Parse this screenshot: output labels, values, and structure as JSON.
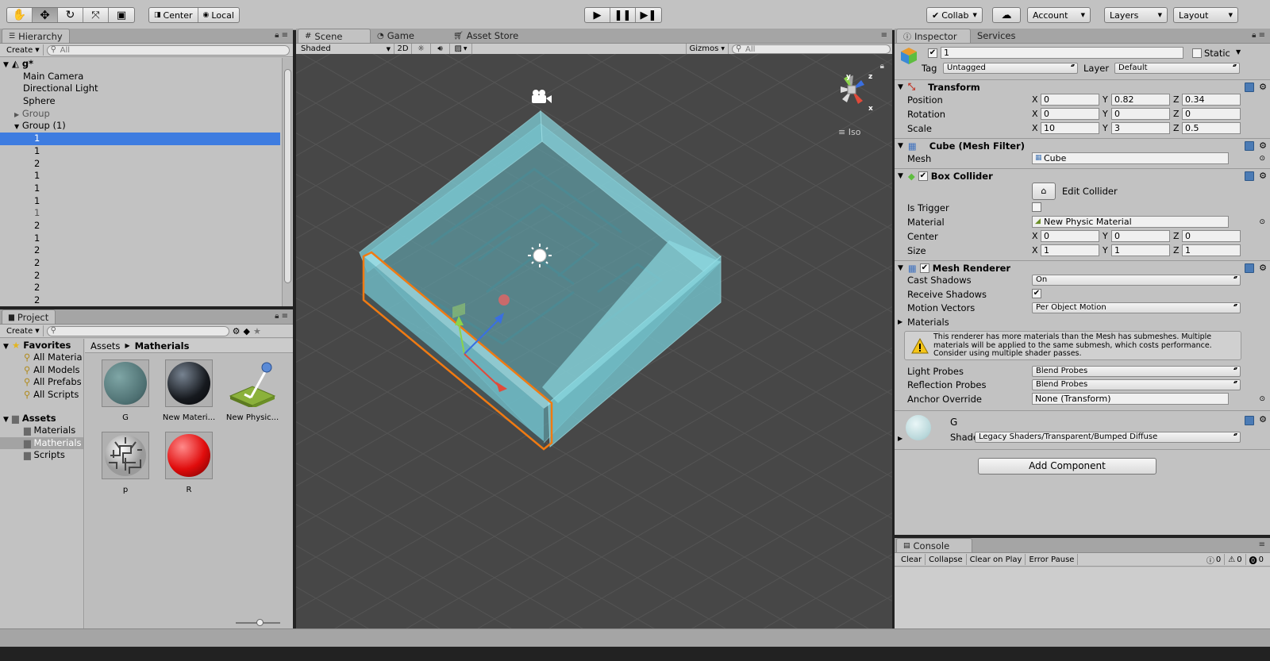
{
  "toolbar": {
    "pivot_center": "Center",
    "pivot_local": "Local",
    "collab": "Collab",
    "account": "Account",
    "layers": "Layers",
    "layout": "Layout"
  },
  "hierarchy": {
    "tab": "Hierarchy",
    "create": "Create",
    "search_placeholder": "All",
    "scene_name": "g*",
    "items": [
      {
        "label": "Main Camera"
      },
      {
        "label": "Directional Light"
      },
      {
        "label": "Sphere"
      },
      {
        "label": "Group"
      },
      {
        "label": "Group (1)"
      },
      {
        "label": "1"
      },
      {
        "label": "1"
      },
      {
        "label": "2"
      },
      {
        "label": "1"
      },
      {
        "label": "1"
      },
      {
        "label": "1"
      },
      {
        "label": "1"
      },
      {
        "label": "2"
      },
      {
        "label": "1"
      },
      {
        "label": "2"
      },
      {
        "label": "2"
      },
      {
        "label": "2"
      },
      {
        "label": "2"
      },
      {
        "label": "2"
      }
    ]
  },
  "project": {
    "tab": "Project",
    "create": "Create",
    "favorites_title": "Favorites",
    "favorites": [
      "All Materia",
      "All Models",
      "All Prefabs",
      "All Scripts"
    ],
    "assets_title": "Assets",
    "folders": [
      "Materials",
      "Matherials",
      "Scripts"
    ],
    "breadcrumb_root": "Assets",
    "breadcrumb_current": "Matherials",
    "assets": [
      {
        "label": "G"
      },
      {
        "label": "New Materi..."
      },
      {
        "label": "New Physic..."
      },
      {
        "label": "p"
      },
      {
        "label": "R"
      }
    ]
  },
  "scene": {
    "tabs": [
      "Scene",
      "Game",
      "Asset Store"
    ],
    "shading": "Shaded",
    "mode_2d": "2D",
    "gizmos": "Gizmos",
    "search_placeholder": "All",
    "projection": "Iso",
    "gizmo_y": "y",
    "gizmo_z": "z",
    "gizmo_x": "x"
  },
  "inspector": {
    "tabs": [
      "Inspector",
      "Services"
    ],
    "object_name": "1",
    "static_label": "Static",
    "tag_label": "Tag",
    "tag_value": "Untagged",
    "layer_label": "Layer",
    "layer_value": "Default",
    "transform": {
      "title": "Transform",
      "position_label": "Position",
      "rotation_label": "Rotation",
      "scale_label": "Scale",
      "position": {
        "x": "0",
        "y": "0.82",
        "z": "0.34"
      },
      "rotation": {
        "x": "0",
        "y": "0",
        "z": "0"
      },
      "scale": {
        "x": "10",
        "y": "3",
        "z": "0.5"
      }
    },
    "axis_x": "X",
    "axis_y": "Y",
    "axis_z": "Z",
    "mesh_filter": {
      "title": "Cube (Mesh Filter)",
      "mesh_label": "Mesh",
      "mesh_value": "Cube"
    },
    "box_collider": {
      "title": "Box Collider",
      "edit_collider": "Edit Collider",
      "is_trigger_label": "Is Trigger",
      "material_label": "Material",
      "material_value": "New Physic Material",
      "center_label": "Center",
      "size_label": "Size",
      "center": {
        "x": "0",
        "y": "0",
        "z": "0"
      },
      "size": {
        "x": "1",
        "y": "1",
        "z": "1"
      }
    },
    "mesh_renderer": {
      "title": "Mesh Renderer",
      "cast_shadows_label": "Cast Shadows",
      "cast_shadows_value": "On",
      "receive_shadows_label": "Receive Shadows",
      "motion_vectors_label": "Motion Vectors",
      "motion_vectors_value": "Per Object Motion",
      "materials_label": "Materials",
      "warning": "This renderer has more materials than the Mesh has submeshes. Multiple materials will be applied to the same submesh, which costs performance. Consider using multiple shader passes.",
      "light_probes_label": "Light Probes",
      "light_probes_value": "Blend Probes",
      "reflection_probes_label": "Reflection Probes",
      "reflection_probes_value": "Blend Probes",
      "anchor_override_label": "Anchor Override",
      "anchor_override_value": "None (Transform)"
    },
    "material": {
      "name": "G",
      "shader_label": "Shader",
      "shader_value": "Legacy Shaders/Transparent/Bumped Diffuse"
    },
    "add_component": "Add Component"
  },
  "console": {
    "tab": "Console",
    "buttons": [
      "Clear",
      "Collapse",
      "Clear on Play",
      "Error Pause"
    ],
    "info_count": "0",
    "warning_count": "0",
    "error_count": "0"
  },
  "colors": {
    "selection": "#3e7ce0",
    "scene_background": "#474747",
    "block_fill": "#7ecfd9",
    "selection_outline": "#f07a12"
  }
}
